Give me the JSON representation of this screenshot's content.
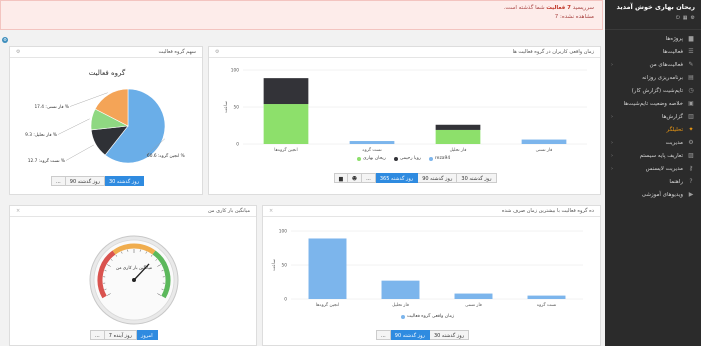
{
  "sidebar": {
    "user_name": "ریحان بهاری خوش آمدید",
    "items": [
      {
        "label": "پروژه‌ها",
        "icon": "folder-icon",
        "arrow": false
      },
      {
        "label": "فعالیت‌ها",
        "icon": "list-icon",
        "arrow": false
      },
      {
        "label": "فعالیت‌های من",
        "icon": "user-task-icon",
        "arrow": true
      },
      {
        "label": "برنامه‌ریزی روزانه",
        "icon": "calendar-icon",
        "arrow": false
      },
      {
        "label": "تایم‌شیت (گزارش کار)",
        "icon": "clock-icon",
        "arrow": false
      },
      {
        "label": "خلاصه وضعیت تایم‌شیت‌ها",
        "icon": "clipboard-icon",
        "arrow": false
      },
      {
        "label": "گزارش‌ها",
        "icon": "report-icon",
        "arrow": true
      },
      {
        "label": "تحلیلگر",
        "icon": "wand-icon",
        "arrow": false,
        "active": true
      },
      {
        "label": "مدیریت",
        "icon": "settings-icon",
        "arrow": true
      },
      {
        "label": "تعاریف پایه سیستم",
        "icon": "database-icon",
        "arrow": true
      },
      {
        "label": "مدیریت لایسنس",
        "icon": "key-icon",
        "arrow": true
      },
      {
        "label": "راهنما",
        "icon": "help-icon",
        "arrow": false
      },
      {
        "label": "ویدیوهای آموزشی",
        "icon": "video-icon",
        "arrow": false
      }
    ]
  },
  "alert": {
    "prefix": "سرریسید",
    "highlight": "7 فعالیت",
    "suffix": "شما گذشته است.",
    "line2": "مشاهده نشده: 7"
  },
  "panel_pie": {
    "title": "سهم گروه فعالیت",
    "buttons": [
      "30 روز گذشته",
      "90 روز گذشته",
      "..."
    ],
    "chart_data": {
      "type": "pie",
      "title": "گروه فعالیت",
      "slices": [
        {
          "label": "انجین گروه: 60.6 %",
          "value": 60.6,
          "color": "#6aaee8"
        },
        {
          "label": "تست گروه: 12.7 %",
          "value": 12.7,
          "color": "#2f3136"
        },
        {
          "label": "فاز تحلیل: 9.3 %",
          "value": 9.3,
          "color": "#8fd882"
        },
        {
          "label": "فاز تستی: 17.4 %",
          "value": 17.4,
          "color": "#f4a457"
        }
      ]
    }
  },
  "panel_time": {
    "title": "زمان واقعی کاربران در گروه فعالیت ها",
    "buttons": [
      "30 روز گذشته",
      "90 روز گذشته",
      "365 روز گذشته",
      "..."
    ],
    "chart_data": {
      "type": "bar",
      "stacked": true,
      "categories": [
        "انجین گروه‌ها",
        "تست گروه",
        "فاز تحلیل",
        "فاز تستی"
      ],
      "ylabel": "ساعت",
      "ylim": [
        0,
        100
      ],
      "yticks": [
        0,
        50,
        100
      ],
      "series": [
        {
          "name": "ریحان بهاری",
          "color": "#8de06b",
          "values": [
            54,
            0,
            19,
            0
          ]
        },
        {
          "name": "رویا رحیمی",
          "color": "#333338",
          "values": [
            35,
            0,
            7,
            0
          ]
        },
        {
          "name": "reza94",
          "color": "#7cb5ec",
          "values": [
            0,
            4,
            0,
            6
          ]
        }
      ]
    }
  },
  "panel_gauge": {
    "title": "میانگین بار کاری من",
    "buttons": [
      "امروز",
      "7 روز آینده",
      "..."
    ],
    "gauge": {
      "label": "میانگین بار کاری من",
      "value": 68,
      "min": 0,
      "max": 100
    }
  },
  "panel_top5": {
    "title": "ده گروه فعالیت با بیشترین زمان صرف شده",
    "buttons": [
      "30 روز گذشته",
      "90 روز گذشته",
      "..."
    ],
    "chart_data": {
      "type": "bar",
      "categories": [
        "انجین گروه‌ها",
        "فاز تحلیل",
        "فاز تستی",
        "تست گروه"
      ],
      "ylabel": "ساعت",
      "ylim": [
        0,
        100
      ],
      "yticks": [
        0,
        50,
        100
      ],
      "series": [
        {
          "name": "زمان واقعی گروه فعالیت",
          "color": "#7cb5ec",
          "values": [
            89,
            27,
            8,
            5
          ]
        }
      ]
    }
  }
}
